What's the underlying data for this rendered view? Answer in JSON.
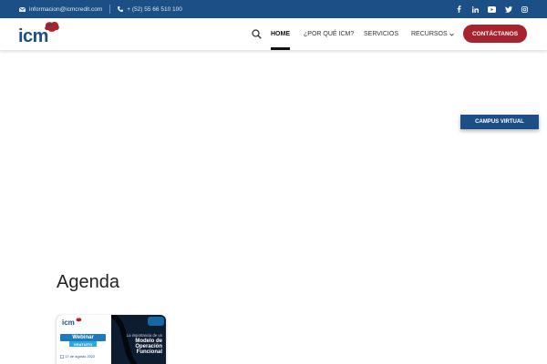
{
  "topbar": {
    "email": "informacion@icmcredit.com",
    "phone": "+ (52) 55 66 510 100",
    "email_icon": "envelope-icon",
    "phone_icon": "phone-icon",
    "social": [
      "facebook-icon",
      "linkedin-icon",
      "youtube-icon",
      "twitter-icon",
      "instagram-icon"
    ],
    "background": "#1b4f86"
  },
  "header": {
    "logo_text": "icm",
    "nav": {
      "home": "HOME",
      "why": "¿POR QUÉ ICM?",
      "services": "SERVICIOS",
      "resources": "RECURSOS"
    },
    "cta": "CONTÁCTANOS",
    "cta_color": "#a8232d"
  },
  "campus_button": "CAMPUS VIRTUAL",
  "agenda": {
    "title": "Agenda",
    "card": {
      "logo": "icm",
      "badge": "Webinar",
      "badge_sub": "GRATUITO",
      "date": "17 de agosto 2022",
      "line1": "La importancia de un",
      "line2": "Modelo de",
      "line3": "Operación",
      "line4": "Funcional"
    }
  }
}
